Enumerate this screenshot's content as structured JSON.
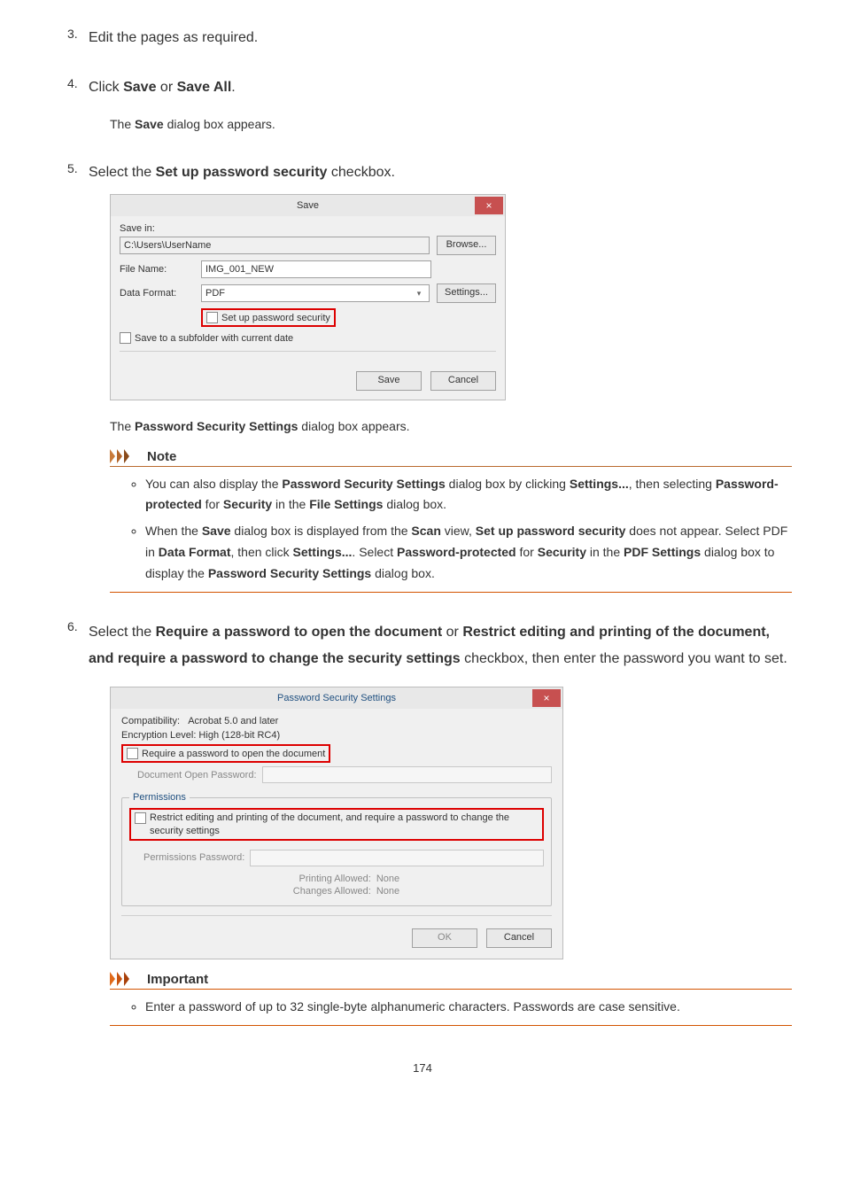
{
  "steps": {
    "s3": {
      "num": "3.",
      "text": "Edit the pages as required."
    },
    "s4": {
      "num": "4.",
      "prefix": "Click ",
      "b1": "Save",
      "mid": " or ",
      "b2": "Save All",
      "suffix": ".",
      "sub_prefix": "The ",
      "sub_b": "Save",
      "sub_suffix": " dialog box appears."
    },
    "s5": {
      "num": "5.",
      "prefix": "Select the ",
      "b1": "Set up password security",
      "suffix": " checkbox.",
      "sub_prefix": "The ",
      "sub_b": "Password Security Settings",
      "sub_suffix": " dialog box appears."
    },
    "s6": {
      "num": "6.",
      "prefix": "Select the ",
      "b1": "Require a password to open the document",
      "mid": " or ",
      "b2": "Restrict editing and printing of the document, and require a password to change the security settings",
      "suffix": " checkbox, then enter the password you want to set."
    }
  },
  "saveDialog": {
    "title": "Save",
    "close": "×",
    "saveIn": "Save in:",
    "path": "C:\\Users\\UserName",
    "browse": "Browse...",
    "fileName": "File Name:",
    "fileNameVal": "IMG_001_NEW",
    "dataFormat": "Data Format:",
    "dataFormatVal": "PDF",
    "settings": "Settings...",
    "setUpPwd": "Set up password security",
    "saveSubfolder": "Save to a subfolder with current date",
    "save": "Save",
    "cancel": "Cancel"
  },
  "note": {
    "title": "Note",
    "li1": {
      "t1": "You can also display the ",
      "b1": "Password Security Settings",
      "t2": " dialog box by clicking ",
      "b2": "Settings...",
      "t3": ", then selecting ",
      "b3": "Password-protected",
      "t4": " for ",
      "b4": "Security",
      "t5": " in the ",
      "b5": "File Settings",
      "t6": " dialog box."
    },
    "li2": {
      "t1": "When the ",
      "b1": "Save",
      "t2": " dialog box is displayed from the ",
      "b2": "Scan",
      "t3": " view, ",
      "b3": "Set up password security",
      "t4": " does not appear. Select PDF in ",
      "b4": "Data Format",
      "t5": ", then click ",
      "b5": "Settings...",
      "t6": ". Select ",
      "b6": "Password-protected",
      "t7": " for ",
      "b7": "Security",
      "t8": " in the ",
      "b8": "PDF Settings",
      "t9": " dialog box to display the ",
      "b9": "Password Security Settings",
      "t10": " dialog box."
    }
  },
  "pssDialog": {
    "title": "Password Security Settings",
    "close": "×",
    "compat_l": "Compatibility:",
    "compat_v": "Acrobat 5.0 and later",
    "enc": "Encryption Level: High (128-bit RC4)",
    "reqOpen": "Require a password to open the document",
    "docOpenPwd": "Document Open Password:",
    "permissions": "Permissions",
    "restrict": "Restrict editing and printing of the document, and require a password to change the security settings",
    "permPwd": "Permissions Password:",
    "printAllowed_l": "Printing Allowed:",
    "printAllowed_v": "None",
    "changesAllowed_l": "Changes Allowed:",
    "changesAllowed_v": "None",
    "ok": "OK",
    "cancel": "Cancel"
  },
  "important": {
    "title": "Important",
    "li1": "Enter a password of up to 32 single-byte alphanumeric characters. Passwords are case sensitive."
  },
  "pagenum": "174"
}
